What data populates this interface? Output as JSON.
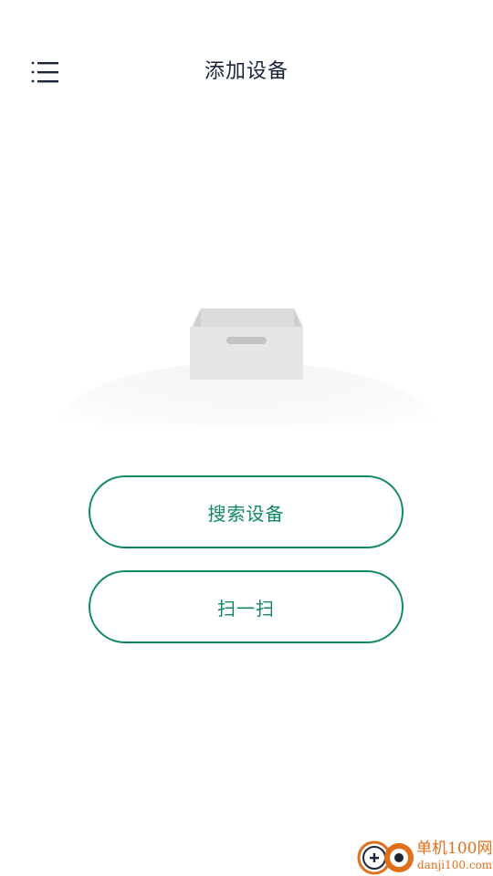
{
  "header": {
    "title": "添加设备",
    "menu_icon": "menu-list-icon"
  },
  "empty_state": {
    "illustration": "empty-box-icon"
  },
  "actions": {
    "search_label": "搜索设备",
    "scan_label": "扫一扫"
  },
  "watermark": {
    "name": "单机100网",
    "domain": "danji100.com"
  },
  "colors": {
    "accent": "#0f8a5f",
    "title_text": "#1c2438",
    "box": "#e6e6e6",
    "watermark": "#e06f1a"
  }
}
